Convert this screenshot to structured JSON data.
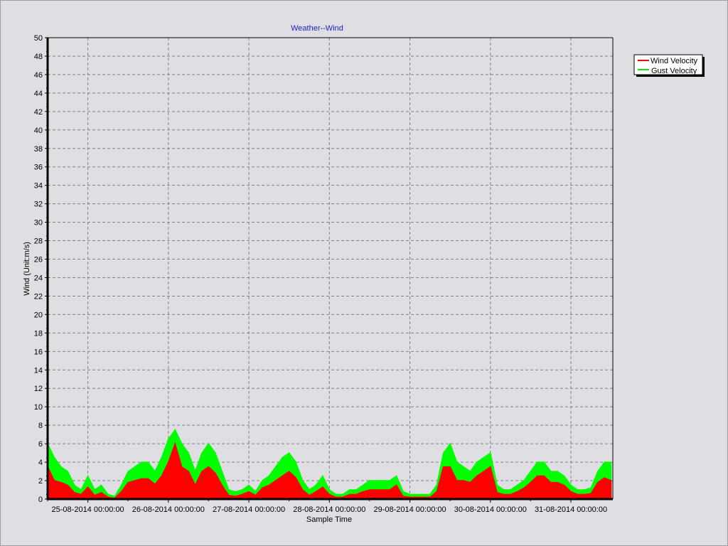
{
  "chart_data": {
    "type": "line",
    "title": "Weather--Wind",
    "xlabel": "Sample Time",
    "ylabel": "Wind (Unit:m/s)",
    "ylim": [
      0,
      50
    ],
    "yticks": [
      "0",
      "2",
      "4",
      "6",
      "8",
      "10",
      "12",
      "14",
      "16",
      "18",
      "20",
      "22",
      "24",
      "26",
      "28",
      "30",
      "32",
      "34",
      "36",
      "38",
      "40",
      "42",
      "44",
      "46",
      "48",
      "50"
    ],
    "x_start": "24-08-2014 12:00:00",
    "x_step_hours": 2,
    "x_range_hours": [
      0,
      168.5
    ],
    "xticks": [
      {
        "label": "25-08-2014 00:00:00",
        "hour": 12
      },
      {
        "label": "26-08-2014 00:00:00",
        "hour": 36
      },
      {
        "label": "27-08-2014 00:00:00",
        "hour": 60
      },
      {
        "label": "28-08-2014 00:00:00",
        "hour": 84
      },
      {
        "label": "29-08-2014 00:00:00",
        "hour": 108
      },
      {
        "label": "30-08-2014 00:00:00",
        "hour": 132
      },
      {
        "label": "31-08-2014 00:00:00",
        "hour": 156
      }
    ],
    "grid": true,
    "legend_position": "top-right-outside",
    "series": [
      {
        "name": "Wind Velocity",
        "color": "#ff0000",
        "values": [
          3.5,
          2,
          1.8,
          1.5,
          0.7,
          0.5,
          1.3,
          0.4,
          0.7,
          0.2,
          0.1,
          0.8,
          1.8,
          2,
          2.2,
          2.2,
          1.6,
          2.5,
          4,
          6,
          3.5,
          3,
          1.5,
          3,
          3.5,
          2.8,
          1.5,
          0.4,
          0.3,
          0.5,
          0.8,
          0.4,
          1.2,
          1.5,
          2,
          2.5,
          3,
          2.3,
          1,
          0.4,
          0.8,
          1.3,
          0.5,
          0.2,
          0.2,
          0.5,
          0.5,
          0.8,
          1,
          1,
          1,
          1,
          1.5,
          0.3,
          0.2,
          0.2,
          0.2,
          0.2,
          0.8,
          3.5,
          3.5,
          2,
          2,
          1.8,
          2.5,
          3,
          3.5,
          0.7,
          0.5,
          0.5,
          0.8,
          1.2,
          1.8,
          2.5,
          2.5,
          1.8,
          1.8,
          1.5,
          0.8,
          0.5,
          0.5,
          0.6,
          1.8,
          2.3,
          2
        ]
      },
      {
        "name": "Gust Velocity",
        "color": "#00ff00",
        "values": [
          6,
          4.5,
          3.5,
          3,
          1.5,
          1,
          2.5,
          1,
          1.5,
          0.5,
          0.3,
          1.5,
          3,
          3.5,
          4,
          4,
          3,
          4.5,
          6.5,
          7.5,
          6,
          5,
          3,
          5,
          6,
          5,
          3,
          1,
          0.8,
          1,
          1.5,
          0.8,
          2,
          2.5,
          3.5,
          4.5,
          5,
          4,
          2,
          1,
          1.5,
          2.5,
          1,
          0.5,
          0.5,
          1,
          1,
          1.5,
          2,
          2,
          2,
          2,
          2.5,
          0.8,
          0.5,
          0.5,
          0.5,
          0.5,
          1.5,
          5,
          6,
          4,
          3.5,
          3,
          4,
          4.5,
          5,
          1.5,
          1,
          1,
          1.5,
          2,
          3,
          4,
          4,
          3,
          3,
          2.5,
          1.5,
          1,
          1,
          1.2,
          3,
          4,
          4
        ]
      }
    ]
  }
}
